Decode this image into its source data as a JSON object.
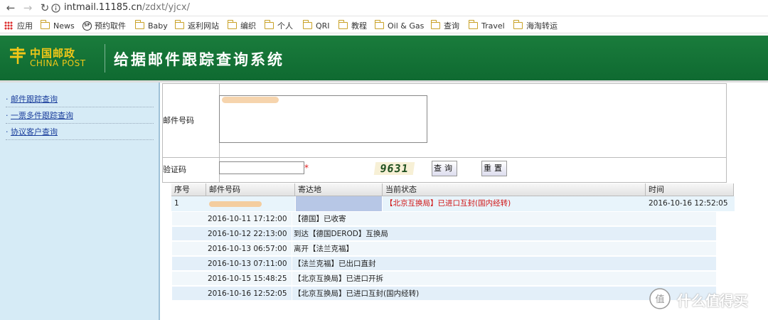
{
  "browser": {
    "url_host": "intmail.11185.cn",
    "url_path": "/zdxt/yjcx/",
    "bookmarks": [
      "应用",
      "News",
      "预约取件",
      "Baby",
      "返利网站",
      "编织",
      "个人",
      "QRI",
      "教程",
      "Oil & Gas",
      "查询",
      "Travel",
      "海淘转运"
    ]
  },
  "banner": {
    "logo_cn": "中国邮政",
    "logo_en": "CHINA POST",
    "title": "给据邮件跟踪查询系统"
  },
  "sidebar": {
    "items": [
      "邮件跟踪查询",
      "一票多件跟踪查询",
      "协议客户查询"
    ]
  },
  "form": {
    "mail_label": "邮件号码",
    "captcha_label": "验证码",
    "required_mark": "*",
    "captcha_text": "9631",
    "query_button": "查询",
    "reset_button": "重置"
  },
  "table": {
    "headers": [
      "序号",
      "邮件号码",
      "寄达地",
      "当前状态",
      "时间"
    ],
    "row": {
      "index": "1",
      "status": "【北京互换局】已进口互封(国内经转)",
      "time": "2016-10-16  12:52:05"
    },
    "details": [
      {
        "time": "2016-10-11 17:12:00",
        "desc": "【德国】已收寄"
      },
      {
        "time": "2016-10-12 22:13:00",
        "desc": "到达【德国DEROD】互换局"
      },
      {
        "time": "2016-10-13 06:57:00",
        "desc": "离开【法兰克福】"
      },
      {
        "time": "2016-10-13 07:11:00",
        "desc": "【法兰克福】已出口直封"
      },
      {
        "time": "2016-10-15 15:48:25",
        "desc": "【北京互换局】已进口开拆"
      },
      {
        "time": "2016-10-16 12:52:05",
        "desc": "【北京互换局】已进口互封(国内经转)"
      }
    ]
  },
  "watermark": {
    "text": "什么值得买"
  },
  "colors": {
    "banner_green": "#1a7c3c",
    "logo_yellow": "#f2c718",
    "status_red": "#d01515",
    "sidebar_bg": "#d6ebf6"
  }
}
